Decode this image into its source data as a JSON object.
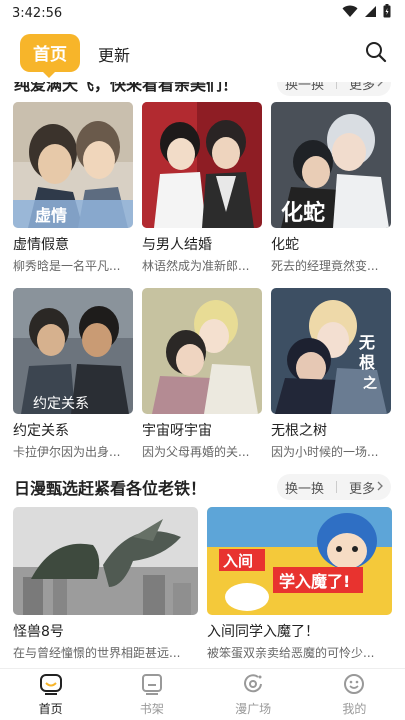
{
  "status_bar": {
    "time": "3:42:56"
  },
  "top_nav": {
    "home_tab": "首页",
    "update_tab": "更新"
  },
  "section1": {
    "title": "纯爱满天飞，快来看看亲美们！",
    "refresh_label": "换一换",
    "more_label": "更多",
    "items": [
      {
        "title": "虚情假意",
        "desc": "柳秀晗是一名平凡..."
      },
      {
        "title": "与男人结婚",
        "desc": "林语然成为准新郎..."
      },
      {
        "title": "化蛇",
        "desc": "死去的经理竟然变..."
      },
      {
        "title": "约定关系",
        "desc": "卡拉伊尔因为出身..."
      },
      {
        "title": "宇宙呀宇宙",
        "desc": "因为父母再婚的关..."
      },
      {
        "title": "无根之树",
        "desc": "因为小时候的一场..."
      }
    ]
  },
  "section2": {
    "title": "日漫甄选赶紧看各位老铁！",
    "refresh_label": "换一换",
    "more_label": "更多",
    "items": [
      {
        "title": "怪兽8号",
        "desc": "在与曾经憧憬的世界相距甚远..."
      },
      {
        "title": "入间同学入魔了！",
        "desc": "被笨蛋双亲卖给恶魔的可怜少..."
      }
    ]
  },
  "bottom_nav": {
    "items": [
      {
        "label": "首页"
      },
      {
        "label": "书架"
      },
      {
        "label": "漫广场"
      },
      {
        "label": "我的"
      }
    ]
  },
  "colors": {
    "accent": "#f7b52a",
    "text": "#222222",
    "muted": "#666666"
  }
}
